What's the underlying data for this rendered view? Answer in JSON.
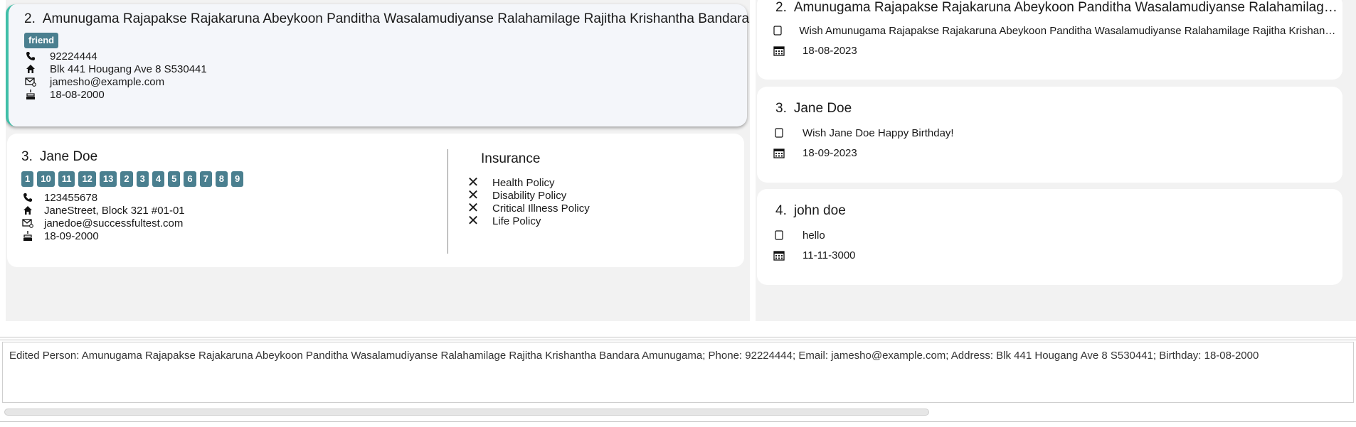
{
  "person_list": {
    "selected": {
      "index": "2.",
      "name": "Amunugama Rajapakse Rajakaruna Abeykoon Panditha Wasalamudiyanse Ralahamilage Rajitha Krishantha Bandara Amunugama",
      "tags": [
        "friend"
      ],
      "phone": "92224444",
      "address": "Blk 441 Hougang Ave 8 S530441",
      "email": "jamesho@example.com",
      "birthday": "18-08-2000"
    },
    "second": {
      "index": "3.",
      "name": "Jane Doe",
      "tags": [
        "1",
        "10",
        "11",
        "12",
        "13",
        "2",
        "3",
        "4",
        "5",
        "6",
        "7",
        "8",
        "9"
      ],
      "phone": "123455678",
      "address": "JaneStreet, Block 321 #01-01",
      "email": "janedoe@successfultest.com",
      "birthday": "18-09-2000",
      "insurance_title": "Insurance",
      "insurance": [
        "Health Policy",
        "Disability Policy",
        "Critical Illness Policy",
        "Life Policy"
      ]
    }
  },
  "reminders": [
    {
      "index": "2.",
      "name": "Amunugama Rajapakse Rajakaruna Abeykoon Panditha Wasalamudiyanse Ralahamilage Rajitha Krishantha Bandara Amunugama",
      "message": "Wish Amunugama Rajapakse Rajakaruna Abeykoon Panditha Wasalamudiyanse Ralahamilage Rajitha Krishantha Bandara Amunugama Happy Birthday!",
      "date": "18-08-2023"
    },
    {
      "index": "3.",
      "name": "Jane Doe",
      "message": "Wish Jane Doe Happy Birthday!",
      "date": "18-09-2023"
    },
    {
      "index": "4.",
      "name": "john doe",
      "message": "hello",
      "date": "11-11-3000"
    }
  ],
  "result": {
    "text": "Edited Person: Amunugama Rajapakse Rajakaruna Abeykoon Panditha Wasalamudiyanse Ralahamilage Rajitha Krishantha Bandara Amunugama; Phone: 92224444; Email: jamesho@example.com; Address: Blk 441 Hougang Ave 8 S530441; Birthday: 18-08-2000"
  },
  "icons": {
    "phone": "phone-icon",
    "address": "home-icon",
    "email": "email-icon",
    "birthday": "cake-icon",
    "reminder_message": "checkbox-icon",
    "reminder_date": "calendar-icon",
    "insurance_unavailable": "cross-icon"
  },
  "colors": {
    "tag_bg": "#4a7f8f",
    "selected_accent": "#3fbfa8",
    "panel_bg": "#f2f2f2"
  }
}
